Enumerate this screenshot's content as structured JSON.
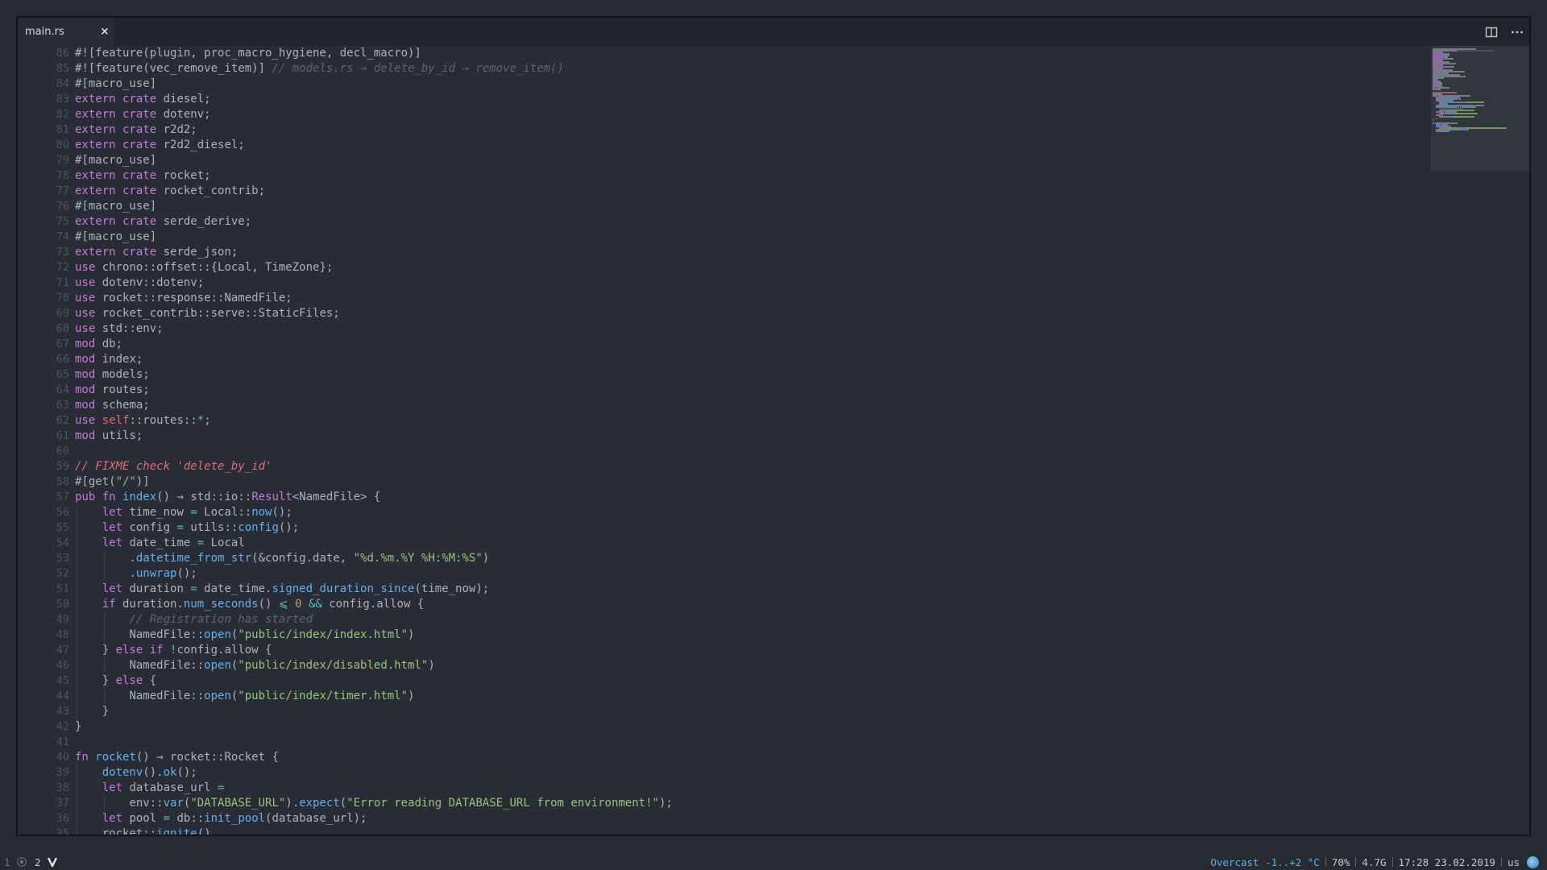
{
  "tab": {
    "title": "main.rs",
    "close": "×"
  },
  "toolbar": {
    "split_icon": "split-editor-icon",
    "more_icon": "more-actions-icon"
  },
  "editor": {
    "line_numbers": [
      "86",
      "85",
      "84",
      "83",
      "82",
      "81",
      "80",
      "79",
      "78",
      "77",
      "76",
      "75",
      "74",
      "73",
      "72",
      "71",
      "70",
      "69",
      "68",
      "67",
      "66",
      "65",
      "64",
      "63",
      "62",
      "61",
      "60",
      "59",
      "58",
      "57",
      "56",
      "55",
      "54",
      "53",
      "52",
      "51",
      "50",
      "49",
      "48",
      "47",
      "46",
      "45",
      "44",
      "43",
      "42",
      "41",
      "40",
      "39",
      "38",
      "37",
      "36",
      "35"
    ],
    "lines": [
      {
        "indent": 0,
        "tokens": [
          [
            "p",
            "#![feature(plugin, proc_macro_hygiene, decl_macro)]"
          ]
        ]
      },
      {
        "indent": 0,
        "tokens": [
          [
            "p",
            "#![feature(vec_remove_item)] "
          ],
          [
            "cm",
            "// models.rs → delete_by_id → remove_item()"
          ]
        ]
      },
      {
        "indent": 0,
        "tokens": [
          [
            "p",
            "#[macro_use]"
          ]
        ]
      },
      {
        "indent": 0,
        "tokens": [
          [
            "kw",
            "extern crate"
          ],
          [
            "p",
            " diesel;"
          ]
        ]
      },
      {
        "indent": 0,
        "tokens": [
          [
            "kw",
            "extern crate"
          ],
          [
            "p",
            " dotenv;"
          ]
        ]
      },
      {
        "indent": 0,
        "tokens": [
          [
            "kw",
            "extern crate"
          ],
          [
            "p",
            " r2d2;"
          ]
        ]
      },
      {
        "indent": 0,
        "tokens": [
          [
            "kw",
            "extern crate"
          ],
          [
            "p",
            " r2d2_diesel;"
          ]
        ]
      },
      {
        "indent": 0,
        "tokens": [
          [
            "p",
            "#[macro_use]"
          ]
        ]
      },
      {
        "indent": 0,
        "tokens": [
          [
            "kw",
            "extern crate"
          ],
          [
            "p",
            " rocket;"
          ]
        ]
      },
      {
        "indent": 0,
        "tokens": [
          [
            "kw",
            "extern crate"
          ],
          [
            "p",
            " rocket_contrib;"
          ]
        ]
      },
      {
        "indent": 0,
        "tokens": [
          [
            "p",
            "#[macro_use]"
          ]
        ]
      },
      {
        "indent": 0,
        "tokens": [
          [
            "kw",
            "extern crate"
          ],
          [
            "p",
            " serde_derive;"
          ]
        ]
      },
      {
        "indent": 0,
        "tokens": [
          [
            "p",
            "#[macro_use]"
          ]
        ]
      },
      {
        "indent": 0,
        "tokens": [
          [
            "kw",
            "extern crate"
          ],
          [
            "p",
            " serde_json;"
          ]
        ]
      },
      {
        "indent": 0,
        "tokens": [
          [
            "kw",
            "use"
          ],
          [
            "p",
            " chrono::offset::{Local, TimeZone};"
          ]
        ]
      },
      {
        "indent": 0,
        "tokens": [
          [
            "kw",
            "use"
          ],
          [
            "p",
            " dotenv::dotenv;"
          ]
        ]
      },
      {
        "indent": 0,
        "tokens": [
          [
            "kw",
            "use"
          ],
          [
            "p",
            " rocket::response::NamedFile;"
          ]
        ]
      },
      {
        "indent": 0,
        "tokens": [
          [
            "kw",
            "use"
          ],
          [
            "p",
            " rocket_contrib::serve::StaticFiles;"
          ]
        ]
      },
      {
        "indent": 0,
        "tokens": [
          [
            "kw",
            "use"
          ],
          [
            "p",
            " std::env;"
          ]
        ]
      },
      {
        "indent": 0,
        "tokens": [
          [
            "kw",
            "mod"
          ],
          [
            "p",
            " db;"
          ]
        ]
      },
      {
        "indent": 0,
        "tokens": [
          [
            "kw",
            "mod"
          ],
          [
            "p",
            " index;"
          ]
        ]
      },
      {
        "indent": 0,
        "tokens": [
          [
            "kw",
            "mod"
          ],
          [
            "p",
            " models;"
          ]
        ]
      },
      {
        "indent": 0,
        "tokens": [
          [
            "kw",
            "mod"
          ],
          [
            "p",
            " routes;"
          ]
        ]
      },
      {
        "indent": 0,
        "tokens": [
          [
            "kw",
            "mod"
          ],
          [
            "p",
            " schema;"
          ]
        ]
      },
      {
        "indent": 0,
        "tokens": [
          [
            "kw",
            "use"
          ],
          [
            "p",
            " "
          ],
          [
            "slf",
            "self"
          ],
          [
            "p",
            "::routes::"
          ],
          [
            "op",
            "*"
          ],
          [
            "p",
            ";"
          ]
        ]
      },
      {
        "indent": 0,
        "tokens": [
          [
            "kw",
            "mod"
          ],
          [
            "p",
            " utils;"
          ]
        ]
      },
      {
        "indent": 0,
        "tokens": []
      },
      {
        "indent": 0,
        "tokens": [
          [
            "fix",
            "// FIXME check 'delete_by_id'"
          ]
        ]
      },
      {
        "indent": 0,
        "tokens": [
          [
            "p",
            "#[get("
          ],
          [
            "str",
            "\"/\""
          ],
          [
            "p",
            ")]"
          ]
        ]
      },
      {
        "indent": 0,
        "tokens": [
          [
            "kw",
            "pub fn"
          ],
          [
            "p",
            " "
          ],
          [
            "fn",
            "index"
          ],
          [
            "p",
            "() → std::io::"
          ],
          [
            "kw",
            "Result"
          ],
          [
            "p",
            "<NamedFile> {"
          ]
        ]
      },
      {
        "indent": 1,
        "tokens": [
          [
            "kw",
            "let"
          ],
          [
            "p",
            " time_now "
          ],
          [
            "op",
            "="
          ],
          [
            "p",
            " Local::"
          ],
          [
            "fn",
            "now"
          ],
          [
            "p",
            "();"
          ]
        ]
      },
      {
        "indent": 1,
        "tokens": [
          [
            "kw",
            "let"
          ],
          [
            "p",
            " config "
          ],
          [
            "op",
            "="
          ],
          [
            "p",
            " utils::"
          ],
          [
            "fn",
            "config"
          ],
          [
            "p",
            "();"
          ]
        ]
      },
      {
        "indent": 1,
        "tokens": [
          [
            "kw",
            "let"
          ],
          [
            "p",
            " date_time "
          ],
          [
            "op",
            "="
          ],
          [
            "p",
            " Local"
          ]
        ]
      },
      {
        "indent": 2,
        "tokens": [
          [
            "p",
            "."
          ],
          [
            "fn",
            "datetime_from_str"
          ],
          [
            "p",
            "(&config.date, "
          ],
          [
            "str",
            "\"%d.%m.%Y %H:%M:%S\""
          ],
          [
            "p",
            ")"
          ]
        ]
      },
      {
        "indent": 2,
        "tokens": [
          [
            "p",
            "."
          ],
          [
            "fn",
            "unwrap"
          ],
          [
            "p",
            "();"
          ]
        ]
      },
      {
        "indent": 1,
        "tokens": [
          [
            "kw",
            "let"
          ],
          [
            "p",
            " duration "
          ],
          [
            "op",
            "="
          ],
          [
            "p",
            " date_time."
          ],
          [
            "fn",
            "signed_duration_since"
          ],
          [
            "p",
            "(time_now);"
          ]
        ]
      },
      {
        "indent": 1,
        "tokens": [
          [
            "kw",
            "if"
          ],
          [
            "p",
            " duration."
          ],
          [
            "fn",
            "num_seconds"
          ],
          [
            "p",
            "() "
          ],
          [
            "op",
            "⩽"
          ],
          [
            "p",
            " "
          ],
          [
            "num",
            "0"
          ],
          [
            "p",
            " "
          ],
          [
            "op",
            "&&"
          ],
          [
            "p",
            " config.allow {"
          ]
        ]
      },
      {
        "indent": 2,
        "tokens": [
          [
            "cm",
            "// Registration has started"
          ]
        ]
      },
      {
        "indent": 2,
        "tokens": [
          [
            "p",
            "NamedFile::"
          ],
          [
            "fn",
            "open"
          ],
          [
            "p",
            "("
          ],
          [
            "str",
            "\"public/index/index.html\""
          ],
          [
            "p",
            ")"
          ]
        ]
      },
      {
        "indent": 1,
        "tokens": [
          [
            "p",
            "} "
          ],
          [
            "kw",
            "else if"
          ],
          [
            "p",
            " "
          ],
          [
            "op",
            "!"
          ],
          [
            "p",
            "config.allow {"
          ]
        ]
      },
      {
        "indent": 2,
        "tokens": [
          [
            "p",
            "NamedFile::"
          ],
          [
            "fn",
            "open"
          ],
          [
            "p",
            "("
          ],
          [
            "str",
            "\"public/index/disabled.html\""
          ],
          [
            "p",
            ")"
          ]
        ]
      },
      {
        "indent": 1,
        "tokens": [
          [
            "p",
            "} "
          ],
          [
            "kw",
            "else"
          ],
          [
            "p",
            " {"
          ]
        ]
      },
      {
        "indent": 2,
        "tokens": [
          [
            "p",
            "NamedFile::"
          ],
          [
            "fn",
            "open"
          ],
          [
            "p",
            "("
          ],
          [
            "str",
            "\"public/index/timer.html\""
          ],
          [
            "p",
            ")"
          ]
        ]
      },
      {
        "indent": 1,
        "tokens": [
          [
            "p",
            "}"
          ]
        ]
      },
      {
        "indent": 0,
        "tokens": [
          [
            "p",
            "}"
          ]
        ]
      },
      {
        "indent": 0,
        "tokens": []
      },
      {
        "indent": 0,
        "tokens": [
          [
            "kw",
            "fn"
          ],
          [
            "p",
            " "
          ],
          [
            "fn",
            "rocket"
          ],
          [
            "p",
            "() → rocket::Rocket {"
          ]
        ]
      },
      {
        "indent": 1,
        "tokens": [
          [
            "fn",
            "dotenv"
          ],
          [
            "p",
            "()."
          ],
          [
            "fn",
            "ok"
          ],
          [
            "p",
            "();"
          ]
        ]
      },
      {
        "indent": 1,
        "tokens": [
          [
            "kw",
            "let"
          ],
          [
            "p",
            " database_url "
          ],
          [
            "op",
            "="
          ]
        ]
      },
      {
        "indent": 2,
        "tokens": [
          [
            "p",
            "env::"
          ],
          [
            "fn",
            "var"
          ],
          [
            "p",
            "("
          ],
          [
            "str",
            "\"DATABASE_URL\""
          ],
          [
            "p",
            ")."
          ],
          [
            "fn",
            "expect"
          ],
          [
            "p",
            "("
          ],
          [
            "str",
            "\"Error reading DATABASE_URL from environment!\""
          ],
          [
            "p",
            ");"
          ]
        ]
      },
      {
        "indent": 1,
        "tokens": [
          [
            "kw",
            "let"
          ],
          [
            "p",
            " pool "
          ],
          [
            "op",
            "="
          ],
          [
            "p",
            " db::"
          ],
          [
            "fn",
            "init_pool"
          ],
          [
            "p",
            "(database_url);"
          ]
        ]
      },
      {
        "indent": 1,
        "tokens": [
          [
            "p",
            "rocket::"
          ],
          [
            "fn",
            "ignite"
          ],
          [
            "p",
            "()"
          ]
        ]
      }
    ]
  },
  "minimap": {
    "name": "minimap"
  },
  "statusbar": {
    "workspace_1": "1",
    "workspace_1_icon": "gear-icon",
    "workspace_2": "2",
    "workspace_2_icon": "vivaldi-icon",
    "weather": "Overcast -1..+2 °C",
    "volume": "70%",
    "memory": "4.7G",
    "clock": "17:28 23.02.2019",
    "keyboard_layout": "us",
    "colors": {
      "weather": "#61afef"
    }
  }
}
